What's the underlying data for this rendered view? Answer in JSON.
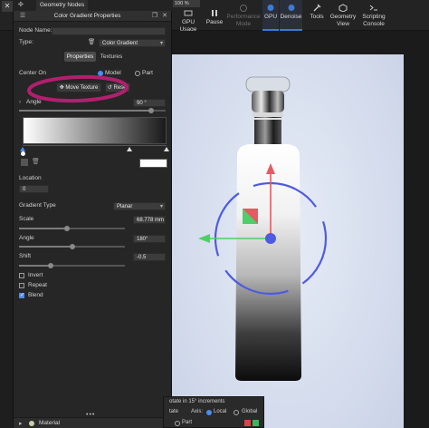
{
  "window": {
    "close_label": "✕",
    "geometry_tab_label": "Geometry Nodes",
    "zoom_value": "100 %"
  },
  "toolbar": {
    "items": [
      {
        "label": "GPU Usage",
        "icon": "gpu-usage-icon"
      },
      {
        "label": "Pause",
        "icon": "pause-icon"
      },
      {
        "label": "Performance Mode",
        "icon": "performance-icon"
      },
      {
        "label": "GPU",
        "icon": "gpu-icon"
      },
      {
        "label": "Denoise",
        "icon": "denoise-icon"
      },
      {
        "label": "Tools",
        "icon": "tools-icon"
      },
      {
        "label": "Geometry View",
        "icon": "geometry-view-icon"
      },
      {
        "label": "Scripting Console",
        "icon": "scripting-console-icon"
      }
    ]
  },
  "panel": {
    "title": "Color Gradient Properties",
    "node_name_label": "Node Name:",
    "type_label": "Type:",
    "type_value": "Color Gradient",
    "tabs": [
      "Properties",
      "Textures"
    ],
    "center_on_label": "Center On",
    "center_options": [
      "Model",
      "Part"
    ],
    "center_selected": "Model",
    "move_texture_label": "Move Texture",
    "reset_label": "Reset",
    "angle_top_label": "Angle",
    "angle_top_value": "90 °",
    "angle_top_fraction": 0.9,
    "location_label": "Location",
    "location_value": "0",
    "gradient_type_label": "Gradient Type",
    "gradient_type_value": "Planar",
    "scale_label": "Scale",
    "scale_value": "68.778 mm",
    "scale_fraction": 0.45,
    "angle_label": "Angle",
    "angle_value": "180°",
    "angle_fraction": 0.5,
    "shift_label": "Shift",
    "shift_value": "-0.5",
    "shift_fraction": 0.3,
    "checkboxes": [
      {
        "label": "Invert",
        "checked": false
      },
      {
        "label": "Repeat",
        "checked": false
      },
      {
        "label": "Blend",
        "checked": true
      }
    ],
    "material_label": "Material",
    "gradient_stops": [
      0.0,
      0.74,
      1.0
    ]
  },
  "rotate_bar": {
    "rotate_text": "otate in 15° increments",
    "axis_prefix": "tate",
    "axis_label": "Axis:",
    "local_label": "Local",
    "global_label": "Global",
    "part_label": "Part"
  },
  "colors": {
    "accent": "#3c7bd6",
    "annotation": "#b0206e",
    "gizmo_ring": "#4f5be0",
    "gizmo_up": "#e35b63",
    "gizmo_left": "#4dd06a"
  }
}
